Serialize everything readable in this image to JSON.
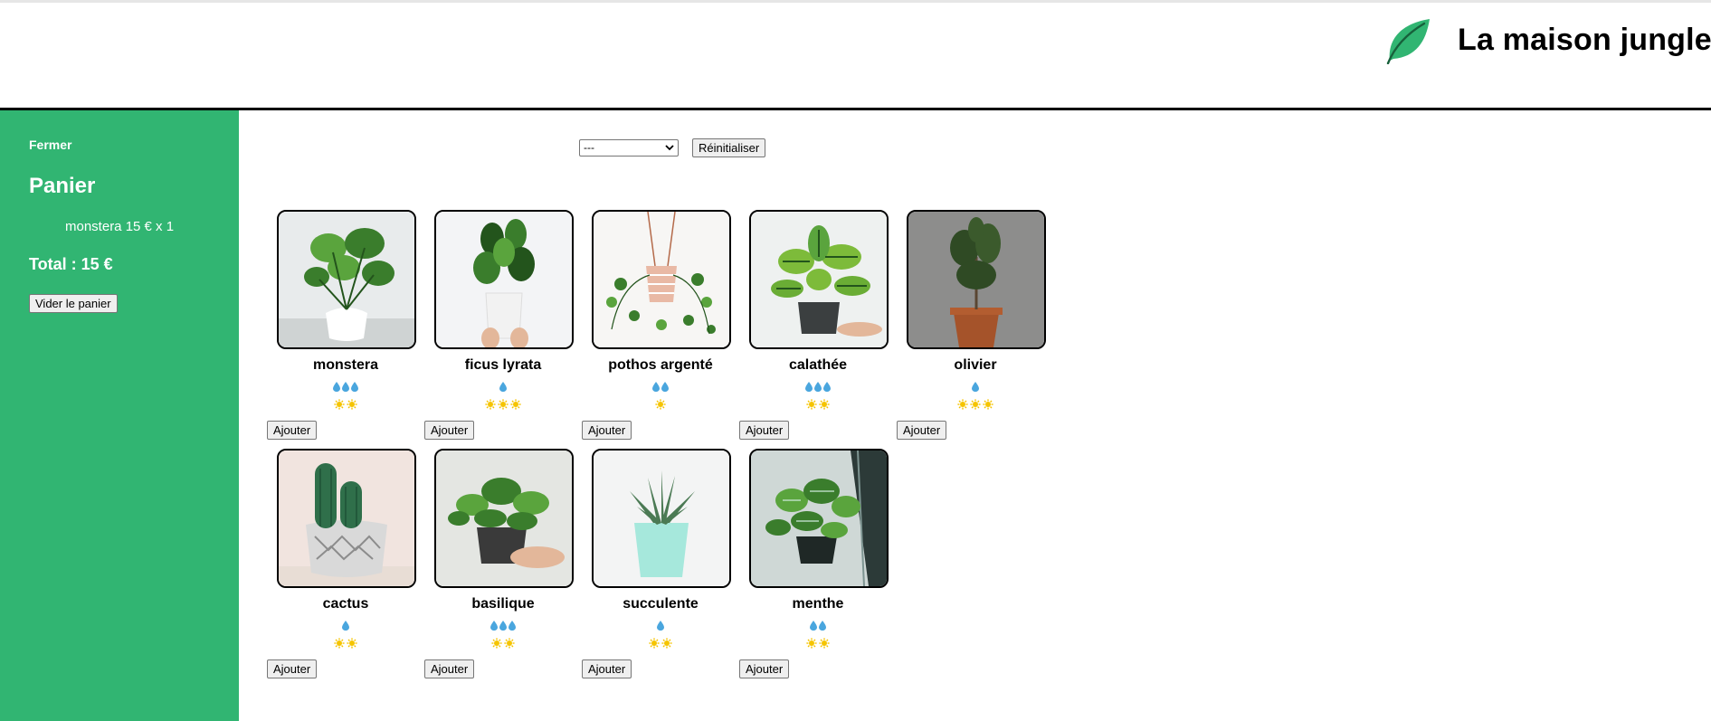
{
  "header": {
    "title": "La maison jungle",
    "logo_icon": "leaf-icon",
    "logo_color": "#31b572"
  },
  "colors": {
    "sidebar_bg": "#31b572",
    "water_drop": "#4aa6de",
    "sun": "#f5c400"
  },
  "cart": {
    "close_label": "Fermer",
    "title": "Panier",
    "items": [
      {
        "text": "monstera 15 € x 1"
      }
    ],
    "total": "Total : 15 €",
    "empty_label": "Vider le panier"
  },
  "filter": {
    "selected": "---",
    "reset_label": "Réinitialiser"
  },
  "plants": [
    {
      "name": "monstera",
      "water": 3,
      "light": 2,
      "add_label": "Ajouter",
      "icon": "monstera-photo"
    },
    {
      "name": "ficus lyrata",
      "water": 1,
      "light": 3,
      "add_label": "Ajouter",
      "icon": "ficus-lyrata-photo"
    },
    {
      "name": "pothos argenté",
      "water": 2,
      "light": 1,
      "add_label": "Ajouter",
      "icon": "pothos-photo"
    },
    {
      "name": "calathée",
      "water": 3,
      "light": 2,
      "add_label": "Ajouter",
      "icon": "calathea-photo"
    },
    {
      "name": "olivier",
      "water": 1,
      "light": 3,
      "add_label": "Ajouter",
      "icon": "olive-tree-photo"
    },
    {
      "name": "cactus",
      "water": 1,
      "light": 2,
      "add_label": "Ajouter",
      "icon": "cactus-photo"
    },
    {
      "name": "basilique",
      "water": 3,
      "light": 2,
      "add_label": "Ajouter",
      "icon": "basil-photo"
    },
    {
      "name": "succulente",
      "water": 1,
      "light": 2,
      "add_label": "Ajouter",
      "icon": "succulent-photo"
    },
    {
      "name": "menthe",
      "water": 2,
      "light": 2,
      "add_label": "Ajouter",
      "icon": "mint-photo"
    }
  ]
}
